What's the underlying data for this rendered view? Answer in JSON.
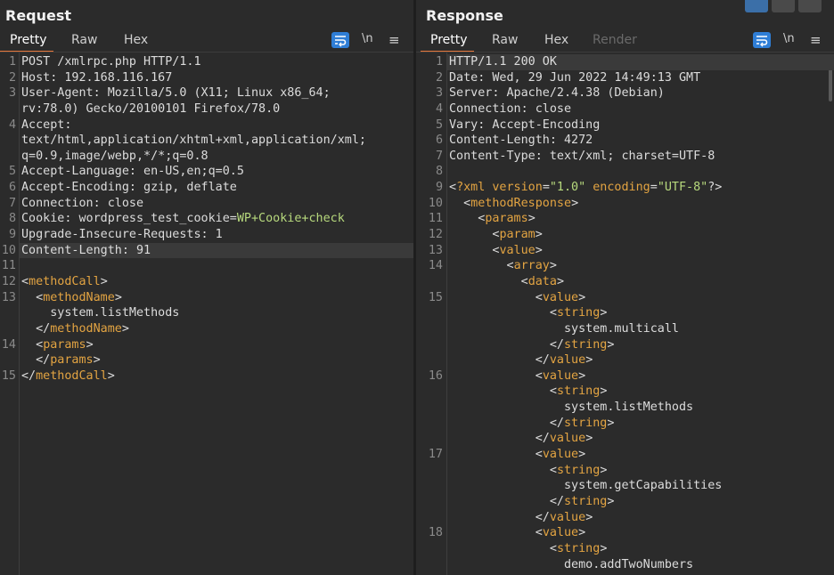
{
  "request": {
    "title": "Request",
    "tabs": [
      "Pretty",
      "Raw",
      "Hex"
    ],
    "newline_label": "\\n",
    "lines": [
      {
        "n": "1",
        "text": "POST /xmlrpc.php HTTP/1.1"
      },
      {
        "n": "2",
        "text": "Host: 192.168.116.167"
      },
      {
        "n": "3",
        "text": "User-Agent: Mozilla/5.0 (X11; Linux x86_64;"
      },
      {
        "n": "",
        "text": "rv:78.0) Gecko/20100101 Firefox/78.0"
      },
      {
        "n": "4",
        "text": "Accept:"
      },
      {
        "n": "",
        "text": "text/html,application/xhtml+xml,application/xml;"
      },
      {
        "n": "",
        "text": "q=0.9,image/webp,*/*;q=0.8"
      },
      {
        "n": "5",
        "text": "Accept-Language: en-US,en;q=0.5"
      },
      {
        "n": "6",
        "text": "Accept-Encoding: gzip, deflate"
      },
      {
        "n": "7",
        "text": "Connection: close"
      },
      {
        "n": "8",
        "text": "Cookie: wordpress_test_cookie=WP+Cookie+check"
      },
      {
        "n": "9",
        "text": "Upgrade-Insecure-Requests: 1"
      },
      {
        "n": "10",
        "text": "Content-Length: 91"
      },
      {
        "n": "11",
        "text": ""
      },
      {
        "n": "12",
        "text": "<methodCall>"
      },
      {
        "n": "13",
        "text": "  <methodName>"
      },
      {
        "n": "",
        "text": "    system.listMethods"
      },
      {
        "n": "",
        "text": "  </methodName>"
      },
      {
        "n": "14",
        "text": "  <params>"
      },
      {
        "n": "",
        "text": "  </params>"
      },
      {
        "n": "15",
        "text": "</methodCall>"
      }
    ]
  },
  "response": {
    "title": "Response",
    "tabs": [
      "Pretty",
      "Raw",
      "Hex",
      "Render"
    ],
    "newline_label": "\\n",
    "lines": [
      {
        "n": "1",
        "text": "HTTP/1.1 200 OK"
      },
      {
        "n": "2",
        "text": "Date: Wed, 29 Jun 2022 14:49:13 GMT"
      },
      {
        "n": "3",
        "text": "Server: Apache/2.4.38 (Debian)"
      },
      {
        "n": "4",
        "text": "Connection: close"
      },
      {
        "n": "5",
        "text": "Vary: Accept-Encoding"
      },
      {
        "n": "6",
        "text": "Content-Length: 4272"
      },
      {
        "n": "7",
        "text": "Content-Type: text/xml; charset=UTF-8"
      },
      {
        "n": "8",
        "text": ""
      },
      {
        "n": "9",
        "text": "<?xml version=\"1.0\" encoding=\"UTF-8\"?>"
      },
      {
        "n": "10",
        "text": "  <methodResponse>"
      },
      {
        "n": "11",
        "text": "    <params>"
      },
      {
        "n": "12",
        "text": "      <param>"
      },
      {
        "n": "13",
        "text": "      <value>"
      },
      {
        "n": "14",
        "text": "        <array>"
      },
      {
        "n": "",
        "text": "          <data>"
      },
      {
        "n": "15",
        "text": "            <value>"
      },
      {
        "n": "",
        "text": "              <string>"
      },
      {
        "n": "",
        "text": "                system.multicall"
      },
      {
        "n": "",
        "text": "              </string>"
      },
      {
        "n": "",
        "text": "            </value>"
      },
      {
        "n": "16",
        "text": "            <value>"
      },
      {
        "n": "",
        "text": "              <string>"
      },
      {
        "n": "",
        "text": "                system.listMethods"
      },
      {
        "n": "",
        "text": "              </string>"
      },
      {
        "n": "",
        "text": "            </value>"
      },
      {
        "n": "17",
        "text": "            <value>"
      },
      {
        "n": "",
        "text": "              <string>"
      },
      {
        "n": "",
        "text": "                system.getCapabilities"
      },
      {
        "n": "",
        "text": "              </string>"
      },
      {
        "n": "",
        "text": "            </value>"
      },
      {
        "n": "18",
        "text": "            <value>"
      },
      {
        "n": "",
        "text": "              <string>"
      },
      {
        "n": "",
        "text": "                demo.addTwoNumbers"
      }
    ]
  },
  "colors": {
    "tab_underline": "#e8773a",
    "wrap_button": "#2f7ed6",
    "xml_tag": "#e3a442",
    "string_value": "#b7d97d"
  }
}
